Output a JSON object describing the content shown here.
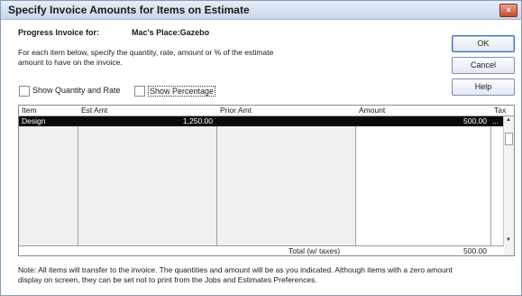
{
  "window": {
    "title": "Specify Invoice Amounts for Items on Estimate",
    "close_glyph": "×"
  },
  "header": {
    "progress_label": "Progress Invoice for:",
    "customer": "Mac's Place:Gazebo",
    "instructions_line1": "For each item below, specify the quantity, rate, amount or % of the estimate",
    "instructions_line2": "amount to have on the invoice."
  },
  "options": {
    "show_qty_rate_label": "Show Quantity and Rate",
    "show_qty_rate_checked": false,
    "show_percentage_label": "Show Percentage",
    "show_percentage_checked": false
  },
  "buttons": {
    "ok": "OK",
    "cancel": "Cancel",
    "help": "Help"
  },
  "table": {
    "columns": [
      "Item",
      "Est Amt",
      "Prior Amt",
      "Amount",
      "Tax"
    ],
    "rows": [
      {
        "item": "Design",
        "est_amt": "1,250.00",
        "prior_amt": "",
        "amount": "500.00",
        "tax": "..."
      }
    ],
    "total_label": "Total (w/ taxes)",
    "total_value": "500.00"
  },
  "note": {
    "line1": "Note: All items will transfer to the invoice. The quantities and amount will be as you indicated. Although items with a zero amount",
    "line2": "display on screen, they can be set not to print from the Jobs and Estimates Preferences."
  },
  "icons": {
    "scroll_up": "▲",
    "scroll_down": "▼"
  }
}
